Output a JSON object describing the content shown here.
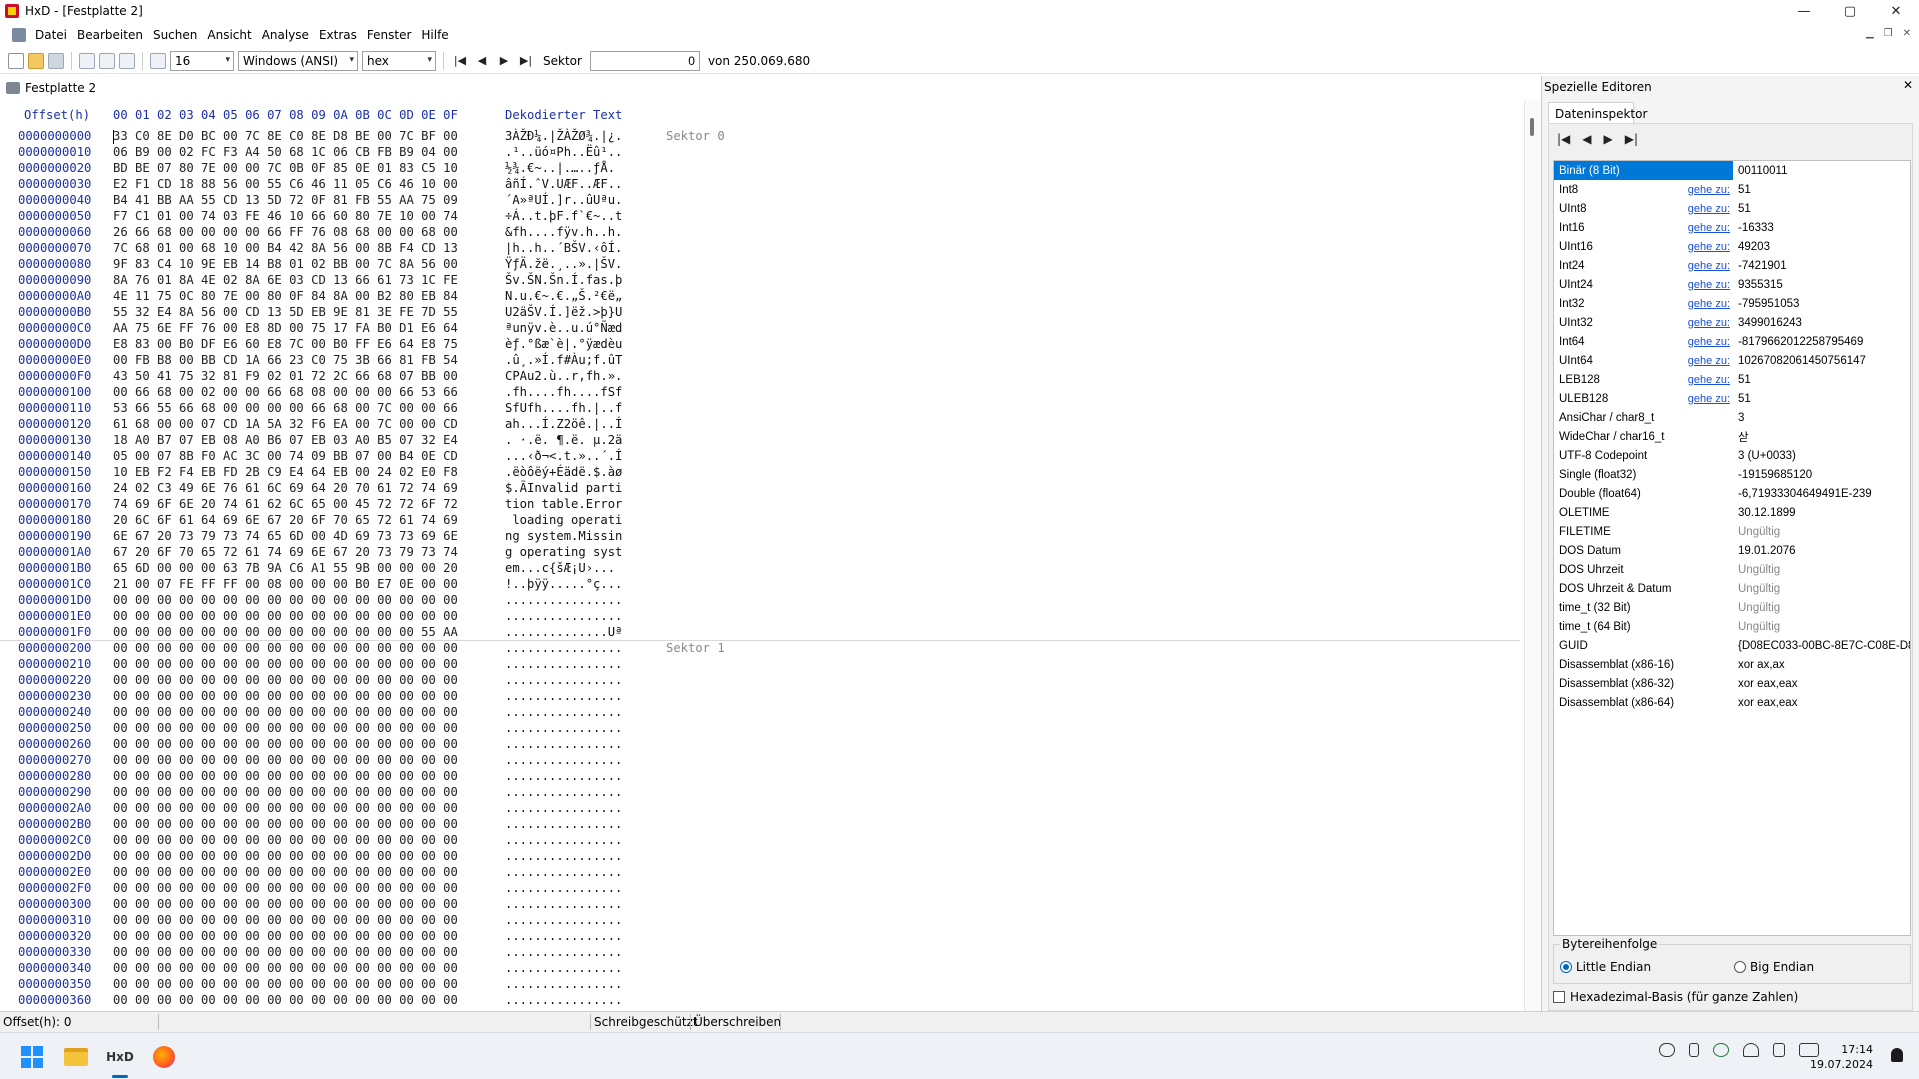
{
  "window": {
    "title": "HxD - [Festplatte 2]"
  },
  "window_controls": {
    "minimize": "—",
    "maximize": "▢",
    "close": "✕"
  },
  "menu": [
    "Datei",
    "Bearbeiten",
    "Suchen",
    "Ansicht",
    "Analyse",
    "Extras",
    "Fenster",
    "Hilfe"
  ],
  "toolbar": {
    "bytes_per_row": "16",
    "charset": "Windows (ANSI)",
    "offset_base": "hex",
    "sector_label": "Sektor",
    "sector_value": "0",
    "sector_total": "von 250.069.680"
  },
  "document_tab": {
    "label": "Festplatte 2"
  },
  "hex_view": {
    "header_offset": "Offset(h)",
    "header_bytes": "00 01 02 03 04 05 06 07 08 09 0A 0B 0C 0D 0E 0F",
    "header_text": "Dekodierter Text",
    "sector_labels": [
      {
        "label": "Sektor 0",
        "row": 0
      },
      {
        "label": "Sektor 1",
        "row": 32
      }
    ],
    "rows": [
      [
        "0000000000",
        "33 C0 8E D0 BC 00 7C 8E C0 8E D8 BE 00 7C BF 00",
        "3ÀŽĐ¼.|ŽÀŽØ¾.|¿."
      ],
      [
        "0000000010",
        "06 B9 00 02 FC F3 A4 50 68 1C 06 CB FB B9 04 00",
        ".¹..üó¤Ph..Ëû¹.."
      ],
      [
        "0000000020",
        "BD BE 07 80 7E 00 00 7C 0B 0F 85 0E 01 83 C5 10",
        "½¾.€~..|.…..ƒÅ."
      ],
      [
        "0000000030",
        "E2 F1 CD 18 88 56 00 55 C6 46 11 05 C6 46 10 00",
        "âñÍ.ˆV.UÆF..ÆF.."
      ],
      [
        "0000000040",
        "B4 41 BB AA 55 CD 13 5D 72 0F 81 FB 55 AA 75 09",
        "´A»ªUÍ.]r..ûUªu."
      ],
      [
        "0000000050",
        "F7 C1 01 00 74 03 FE 46 10 66 60 80 7E 10 00 74",
        "÷Á..t.þF.f`€~..t"
      ],
      [
        "0000000060",
        "26 66 68 00 00 00 00 66 FF 76 08 68 00 00 68 00",
        "&fh....fÿv.h..h."
      ],
      [
        "0000000070",
        "7C 68 01 00 68 10 00 B4 42 8A 56 00 8B F4 CD 13",
        "|h..h..´BŠV.‹ôÍ."
      ],
      [
        "0000000080",
        "9F 83 C4 10 9E EB 14 B8 01 02 BB 00 7C 8A 56 00",
        "ŸƒÄ.žë.¸..».|ŠV."
      ],
      [
        "0000000090",
        "8A 76 01 8A 4E 02 8A 6E 03 CD 13 66 61 73 1C FE",
        "Šv.ŠN.Šn.Í.fas.þ"
      ],
      [
        "00000000A0",
        "4E 11 75 0C 80 7E 00 80 0F 84 8A 00 B2 80 EB 84",
        "N.u.€~.€.„Š.²€ë„"
      ],
      [
        "00000000B0",
        "55 32 E4 8A 56 00 CD 13 5D EB 9E 81 3E FE 7D 55",
        "U2äŠV.Í.]ëž.>þ}U"
      ],
      [
        "00000000C0",
        "AA 75 6E FF 76 00 E8 8D 00 75 17 FA B0 D1 E6 64",
        "ªunÿv.è..u.ú°Ñæd"
      ],
      [
        "00000000D0",
        "E8 83 00 B0 DF E6 60 E8 7C 00 B0 FF E6 64 E8 75",
        "èƒ.°ßæ`è|.°ÿædèu"
      ],
      [
        "00000000E0",
        "00 FB B8 00 BB CD 1A 66 23 C0 75 3B 66 81 FB 54",
        ".û¸.»Í.f#Àu;f.ûT"
      ],
      [
        "00000000F0",
        "43 50 41 75 32 81 F9 02 01 72 2C 66 68 07 BB 00",
        "CPAu2.ù..r,fh.»."
      ],
      [
        "0000000100",
        "00 66 68 00 02 00 00 66 68 08 00 00 00 66 53 66",
        ".fh....fh....fSf"
      ],
      [
        "0000000110",
        "53 66 55 66 68 00 00 00 00 66 68 00 7C 00 00 66",
        "SfUfh....fh.|..f"
      ],
      [
        "0000000120",
        "61 68 00 00 07 CD 1A 5A 32 F6 EA 00 7C 00 00 CD",
        "ah...Í.Z2öê.|..Í"
      ],
      [
        "0000000130",
        "18 A0 B7 07 EB 08 A0 B6 07 EB 03 A0 B5 07 32 E4",
        ". ·.ë. ¶.ë. µ.2ä"
      ],
      [
        "0000000140",
        "05 00 07 8B F0 AC 3C 00 74 09 BB 07 00 B4 0E CD",
        "...‹ð¬<.t.»..´.Í"
      ],
      [
        "0000000150",
        "10 EB F2 F4 EB FD 2B C9 E4 64 EB 00 24 02 E0 F8",
        ".ëòôëý+Éädë.$.àø"
      ],
      [
        "0000000160",
        "24 02 C3 49 6E 76 61 6C 69 64 20 70 61 72 74 69",
        "$.ÃInvalid parti"
      ],
      [
        "0000000170",
        "74 69 6F 6E 20 74 61 62 6C 65 00 45 72 72 6F 72",
        "tion table.Error"
      ],
      [
        "0000000180",
        "20 6C 6F 61 64 69 6E 67 20 6F 70 65 72 61 74 69",
        " loading operati"
      ],
      [
        "0000000190",
        "6E 67 20 73 79 73 74 65 6D 00 4D 69 73 73 69 6E",
        "ng system.Missin"
      ],
      [
        "00000001A0",
        "67 20 6F 70 65 72 61 74 69 6E 67 20 73 79 73 74",
        "g operating syst"
      ],
      [
        "00000001B0",
        "65 6D 00 00 00 63 7B 9A C6 A1 55 9B 00 00 00 20",
        "em...c{šÆ¡U›..."
      ],
      [
        "00000001C0",
        "21 00 07 FE FF FF 00 08 00 00 00 B0 E7 0E 00 00",
        "!..þÿÿ.....°ç..."
      ],
      [
        "00000001D0",
        "00 00 00 00 00 00 00 00 00 00 00 00 00 00 00 00",
        "................"
      ],
      [
        "00000001E0",
        "00 00 00 00 00 00 00 00 00 00 00 00 00 00 00 00",
        "................"
      ],
      [
        "00000001F0",
        "00 00 00 00 00 00 00 00 00 00 00 00 00 00 55 AA",
        "..............Uª"
      ],
      [
        "0000000200",
        "00 00 00 00 00 00 00 00 00 00 00 00 00 00 00 00",
        "................"
      ],
      [
        "0000000210",
        "00 00 00 00 00 00 00 00 00 00 00 00 00 00 00 00",
        "................"
      ],
      [
        "0000000220",
        "00 00 00 00 00 00 00 00 00 00 00 00 00 00 00 00",
        "................"
      ],
      [
        "0000000230",
        "00 00 00 00 00 00 00 00 00 00 00 00 00 00 00 00",
        "................"
      ],
      [
        "0000000240",
        "00 00 00 00 00 00 00 00 00 00 00 00 00 00 00 00",
        "................"
      ],
      [
        "0000000250",
        "00 00 00 00 00 00 00 00 00 00 00 00 00 00 00 00",
        "................"
      ],
      [
        "0000000260",
        "00 00 00 00 00 00 00 00 00 00 00 00 00 00 00 00",
        "................"
      ],
      [
        "0000000270",
        "00 00 00 00 00 00 00 00 00 00 00 00 00 00 00 00",
        "................"
      ],
      [
        "0000000280",
        "00 00 00 00 00 00 00 00 00 00 00 00 00 00 00 00",
        "................"
      ],
      [
        "0000000290",
        "00 00 00 00 00 00 00 00 00 00 00 00 00 00 00 00",
        "................"
      ],
      [
        "00000002A0",
        "00 00 00 00 00 00 00 00 00 00 00 00 00 00 00 00",
        "................"
      ],
      [
        "00000002B0",
        "00 00 00 00 00 00 00 00 00 00 00 00 00 00 00 00",
        "................"
      ],
      [
        "00000002C0",
        "00 00 00 00 00 00 00 00 00 00 00 00 00 00 00 00",
        "................"
      ],
      [
        "00000002D0",
        "00 00 00 00 00 00 00 00 00 00 00 00 00 00 00 00",
        "................"
      ],
      [
        "00000002E0",
        "00 00 00 00 00 00 00 00 00 00 00 00 00 00 00 00",
        "................"
      ],
      [
        "00000002F0",
        "00 00 00 00 00 00 00 00 00 00 00 00 00 00 00 00",
        "................"
      ],
      [
        "0000000300",
        "00 00 00 00 00 00 00 00 00 00 00 00 00 00 00 00",
        "................"
      ],
      [
        "0000000310",
        "00 00 00 00 00 00 00 00 00 00 00 00 00 00 00 00",
        "................"
      ],
      [
        "0000000320",
        "00 00 00 00 00 00 00 00 00 00 00 00 00 00 00 00",
        "................"
      ],
      [
        "0000000330",
        "00 00 00 00 00 00 00 00 00 00 00 00 00 00 00 00",
        "................"
      ],
      [
        "0000000340",
        "00 00 00 00 00 00 00 00 00 00 00 00 00 00 00 00",
        "................"
      ],
      [
        "0000000350",
        "00 00 00 00 00 00 00 00 00 00 00 00 00 00 00 00",
        "................"
      ],
      [
        "0000000360",
        "00 00 00 00 00 00 00 00 00 00 00 00 00 00 00 00",
        "................"
      ]
    ]
  },
  "side_panel": {
    "title": "Spezielle Editoren",
    "close": "✕",
    "tab": "Dateninspektor",
    "nav": [
      "|◀",
      "◀",
      "▶",
      "▶|"
    ],
    "rows": [
      {
        "name": "Binär (8 Bit)",
        "link": "",
        "value": "00110011",
        "selected": true
      },
      {
        "name": "Int8",
        "link": "gehe zu:",
        "value": "51"
      },
      {
        "name": "UInt8",
        "link": "gehe zu:",
        "value": "51"
      },
      {
        "name": "Int16",
        "link": "gehe zu:",
        "value": "-16333"
      },
      {
        "name": "UInt16",
        "link": "gehe zu:",
        "value": "49203"
      },
      {
        "name": "Int24",
        "link": "gehe zu:",
        "value": "-7421901"
      },
      {
        "name": "UInt24",
        "link": "gehe zu:",
        "value": "9355315"
      },
      {
        "name": "Int32",
        "link": "gehe zu:",
        "value": "-795951053"
      },
      {
        "name": "UInt32",
        "link": "gehe zu:",
        "value": "3499016243"
      },
      {
        "name": "Int64",
        "link": "gehe zu:",
        "value": "-8179662012258795469"
      },
      {
        "name": "UInt64",
        "link": "gehe zu:",
        "value": "10267082061450756147"
      },
      {
        "name": "LEB128",
        "link": "gehe zu:",
        "value": "51"
      },
      {
        "name": "ULEB128",
        "link": "gehe zu:",
        "value": "51"
      },
      {
        "name": "AnsiChar / char8_t",
        "link": "",
        "value": "3"
      },
      {
        "name": "WideChar / char16_t",
        "link": "",
        "value": "삳"
      },
      {
        "name": "UTF-8 Codepoint",
        "link": "",
        "value": "3 (U+0033)"
      },
      {
        "name": "Single (float32)",
        "link": "",
        "value": "-19159685120"
      },
      {
        "name": "Double (float64)",
        "link": "",
        "value": "-6,71933304649491E-239"
      },
      {
        "name": "OLETIME",
        "link": "",
        "value": "30.12.1899"
      },
      {
        "name": "FILETIME",
        "link": "",
        "value": "Ungültig",
        "grey": true
      },
      {
        "name": "DOS Datum",
        "link": "",
        "value": "19.01.2076"
      },
      {
        "name": "DOS Uhrzeit",
        "link": "",
        "value": "Ungültig",
        "grey": true
      },
      {
        "name": "DOS Uhrzeit & Datum",
        "link": "",
        "value": "Ungültig",
        "grey": true
      },
      {
        "name": "time_t (32 Bit)",
        "link": "",
        "value": "Ungültig",
        "grey": true
      },
      {
        "name": "time_t (64 Bit)",
        "link": "",
        "value": "Ungültig",
        "grey": true
      },
      {
        "name": "GUID",
        "link": "",
        "value": "{D08EC033-00BC-8E7C-C08E-D8BE"
      },
      {
        "name": "Disassemblat (x86-16)",
        "link": "",
        "value": "xor ax,ax"
      },
      {
        "name": "Disassemblat (x86-32)",
        "link": "",
        "value": "xor eax,eax"
      },
      {
        "name": "Disassemblat (x86-64)",
        "link": "",
        "value": "xor eax,eax"
      }
    ],
    "byteorder_label": "Bytereihenfolge",
    "little_endian": "Little Endian",
    "big_endian": "Big Endian",
    "hex_basis": "Hexadezimal-Basis (für ganze Zahlen)"
  },
  "statusbar": {
    "offset": "Offset(h): 0",
    "readonly": "Schreibgeschützt",
    "mode": "Überschreiben"
  },
  "taskbar": {
    "hxd": "HxD",
    "time": "17:14",
    "date": "19.07.2024"
  }
}
